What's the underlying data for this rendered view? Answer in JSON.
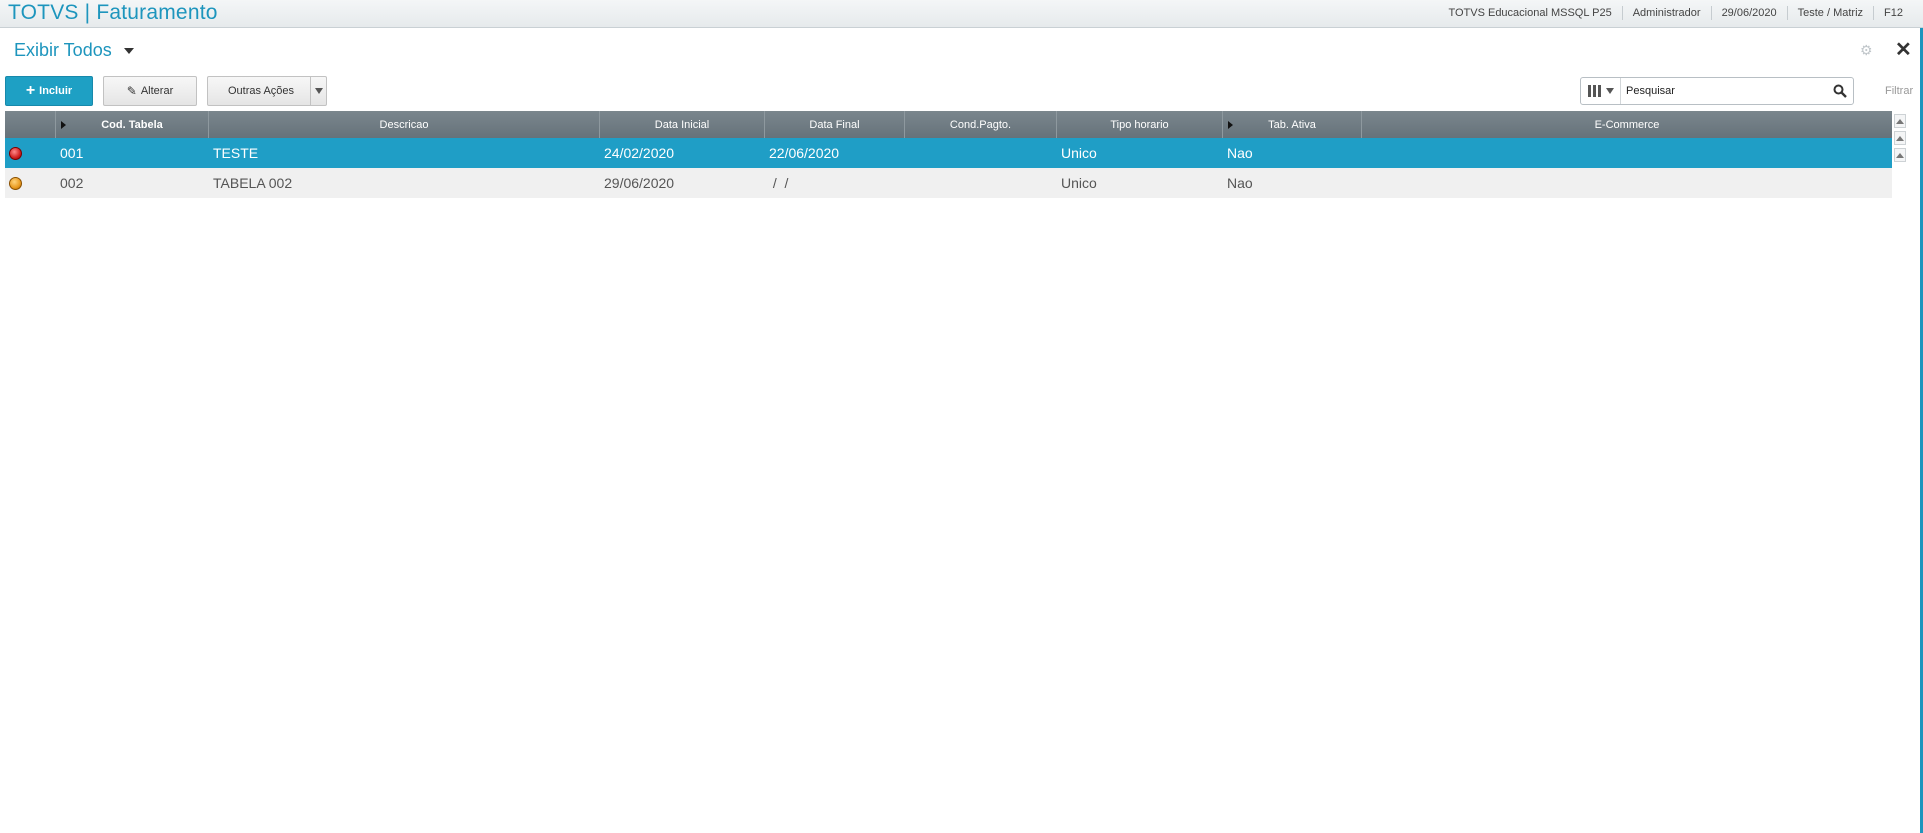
{
  "app": {
    "title": "TOTVS | Faturamento",
    "status": [
      "TOTVS Educacional MSSQL P25",
      "Administrador",
      "29/06/2020",
      "Teste / Matriz",
      "F12"
    ]
  },
  "view": {
    "title": "Exibir Todos",
    "close": "✕"
  },
  "toolbar": {
    "incluir": "Incluir",
    "alterar": "Alterar",
    "outras": "Outras Ações"
  },
  "search": {
    "value": "Pesquisar",
    "filter": "Filtrar"
  },
  "grid": {
    "headers": [
      "",
      "Cod. Tabela",
      "Descricao",
      "Data Inicial",
      "Data Final",
      "Cond.Pagto.",
      "Tipo horario",
      "Tab. Ativa",
      "E-Commerce"
    ],
    "rows": [
      {
        "status": "red",
        "cod": "001",
        "descricao": "TESTE",
        "data_inicial": "24/02/2020",
        "data_final": "22/06/2020",
        "cond": "",
        "tipo": "Unico",
        "ativa": "Nao",
        "ecommerce": "",
        "selected": true
      },
      {
        "status": "orange",
        "cod": "002",
        "descricao": "TABELA 002",
        "data_inicial": "29/06/2020",
        "data_final": " /  /",
        "cond": "",
        "tipo": "Unico",
        "ativa": "Nao",
        "ecommerce": "",
        "selected": false
      }
    ]
  },
  "colors": {
    "accent": "#1d95bd",
    "selected_row": "#1f9ec6",
    "header": "#6f7b82"
  }
}
